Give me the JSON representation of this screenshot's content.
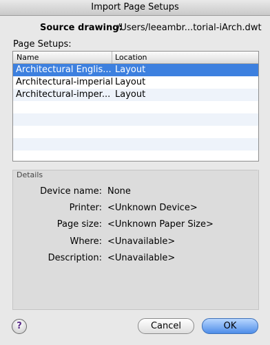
{
  "window": {
    "title": "Import Page Setups"
  },
  "source": {
    "label": "Source drawing:",
    "value": "/Users/leeambr...torial-iArch.dwt"
  },
  "page_setups": {
    "label": "Page Setups:",
    "columns": [
      "Name",
      "Location"
    ],
    "rows": [
      {
        "name": "Architectural Englis...",
        "location": "Layout",
        "selected": true
      },
      {
        "name": "Architectural-imperial",
        "location": "Layout",
        "selected": false
      },
      {
        "name": "Architectural-imper...",
        "location": "Layout",
        "selected": false
      }
    ]
  },
  "details": {
    "label": "Details",
    "fields": [
      {
        "label": "Device name:",
        "value": "None"
      },
      {
        "label": "Printer:",
        "value": "<Unknown Device>"
      },
      {
        "label": "Page size:",
        "value": "<Unknown Paper Size>"
      },
      {
        "label": "Where:",
        "value": "<Unavailable>"
      },
      {
        "label": "Description:",
        "value": "<Unavailable>"
      }
    ]
  },
  "buttons": {
    "help": "?",
    "cancel": "Cancel",
    "ok": "OK"
  }
}
